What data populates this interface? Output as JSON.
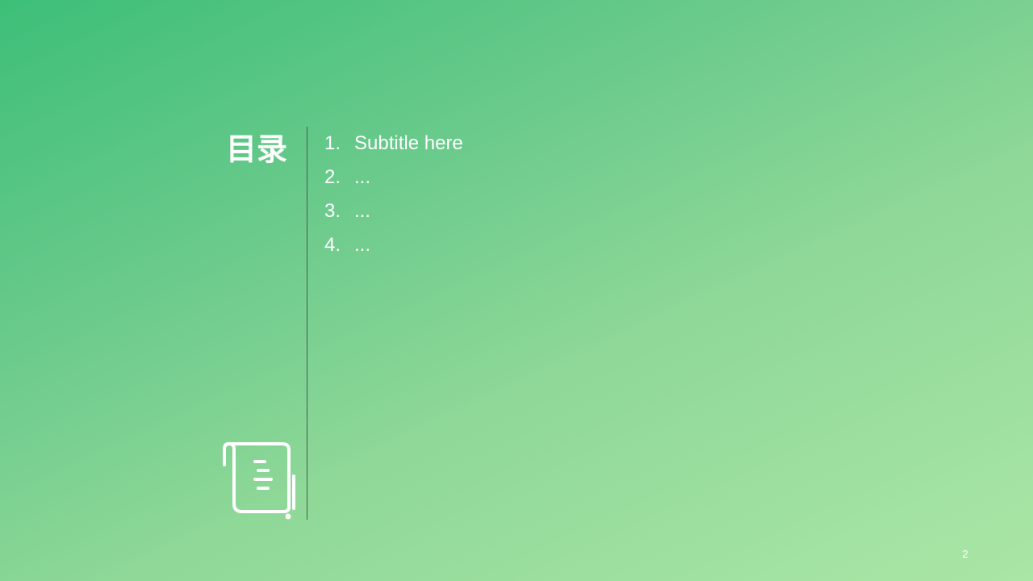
{
  "slide": {
    "title": "目录",
    "items": [
      {
        "number": "1.",
        "label": "Subtitle here"
      },
      {
        "number": "2.",
        "label": "..."
      },
      {
        "number": "3.",
        "label": "..."
      },
      {
        "number": "4.",
        "label": "..."
      }
    ],
    "page_number": "2",
    "icon": "scroll-icon"
  },
  "colors": {
    "background_start": "#3dbf78",
    "background_end": "#aae6a6",
    "text": "#ffffff",
    "divider": "#4a5a4e"
  }
}
